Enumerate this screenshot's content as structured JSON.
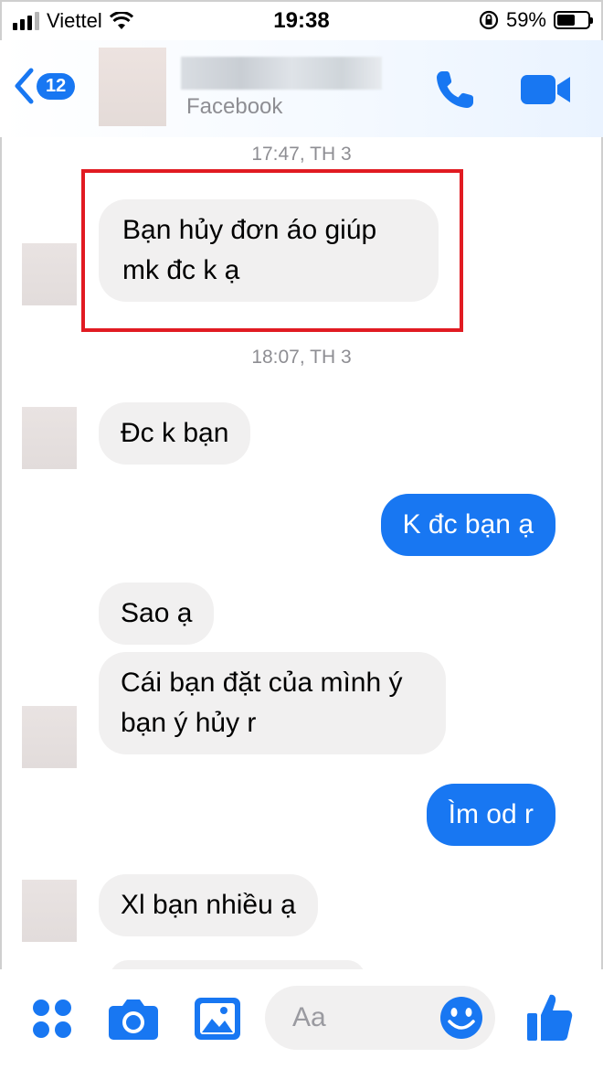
{
  "status_bar": {
    "carrier": "Viettel",
    "time": "19:38",
    "battery_percent": "59%",
    "battery_level": 0.59,
    "signal_icon": "signal-bars-icon",
    "wifi_icon": "wifi-icon",
    "lock_icon": "orientation-lock-icon"
  },
  "header": {
    "unread_count": "12",
    "subtitle": "Facebook",
    "call_icon": "phone-icon",
    "video_icon": "video-camera-icon",
    "accent": "#1877f2"
  },
  "chat": {
    "timestamps": [
      "17:47, TH 3",
      "18:07, TH 3"
    ],
    "messages": [
      {
        "side": "incoming",
        "text": "Bạn hủy đơn áo giúp mk đc k ạ"
      },
      {
        "side": "incoming",
        "text": "Đc k bạn"
      },
      {
        "side": "outgoing",
        "text": "K đc bạn ạ"
      },
      {
        "side": "incoming",
        "text": "Sao ạ"
      },
      {
        "side": "incoming",
        "text": "Cái bạn đặt của mình ý bạn ý hủy r"
      },
      {
        "side": "outgoing",
        "text": "Ìm od r"
      },
      {
        "side": "incoming",
        "text": "Xl bạn nhiều ạ"
      }
    ],
    "highlight_color": "#e11b22"
  },
  "input_bar": {
    "placeholder": "Aa",
    "icons": [
      "apps-grid-icon",
      "camera-icon",
      "photo-icon",
      "emoji-icon",
      "thumbs-up-icon"
    ]
  }
}
